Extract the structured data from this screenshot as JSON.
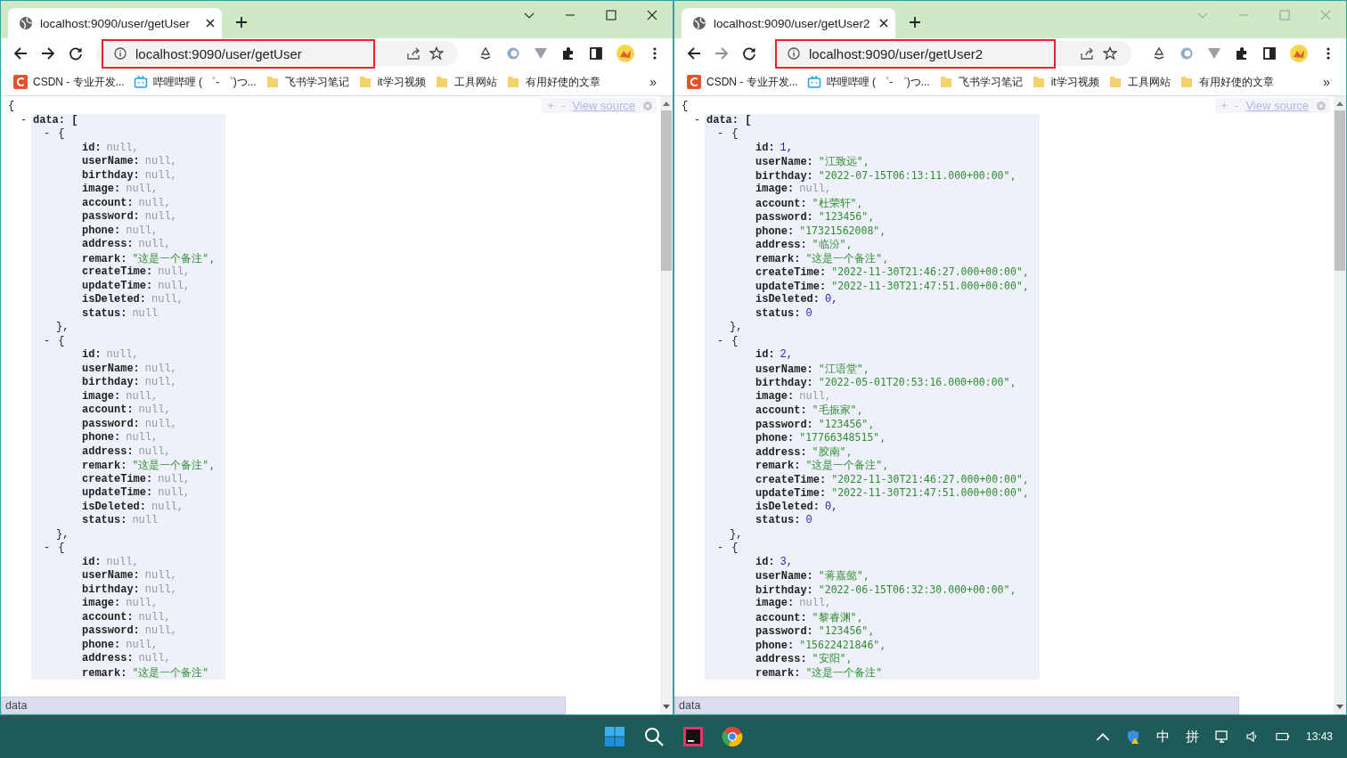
{
  "windows": [
    {
      "active": true,
      "tab_title": "localhost:9090/user/getUser",
      "url": "localhost:9090/user/getUser",
      "url_highlighted": true,
      "bookmarks": [
        {
          "label": "CSDN - 专业开发...",
          "kind": "csdn"
        },
        {
          "label": "哔哩哔哩 ( ゜- ゜)つ...",
          "kind": "tv"
        },
        {
          "label": "飞书学习笔记",
          "kind": "folder"
        },
        {
          "label": "it学习视频",
          "kind": "folder"
        },
        {
          "label": "工具网站",
          "kind": "folder"
        },
        {
          "label": "有用好使的文章",
          "kind": "folder"
        }
      ],
      "bookmarks_more": "»",
      "view_source": {
        "plus": "+",
        "minus": "-",
        "label": "View source"
      },
      "json_view": {
        "open": "{",
        "toggle": "-",
        "data_key": "data: [",
        "records": [
          {
            "toggle": "-",
            "open": "{",
            "close": "},",
            "fields": [
              {
                "key": "id:",
                "value": "null,",
                "kind": "null"
              },
              {
                "key": "userName:",
                "value": "null,",
                "kind": "null"
              },
              {
                "key": "birthday:",
                "value": "null,",
                "kind": "null"
              },
              {
                "key": "image:",
                "value": "null,",
                "kind": "null"
              },
              {
                "key": "account:",
                "value": "null,",
                "kind": "null"
              },
              {
                "key": "password:",
                "value": "null,",
                "kind": "null"
              },
              {
                "key": "phone:",
                "value": "null,",
                "kind": "null"
              },
              {
                "key": "address:",
                "value": "null,",
                "kind": "null"
              },
              {
                "key": "remark:",
                "value": "\"这是一个备注\",",
                "kind": "string"
              },
              {
                "key": "createTime:",
                "value": "null,",
                "kind": "null"
              },
              {
                "key": "updateTime:",
                "value": "null,",
                "kind": "null"
              },
              {
                "key": "isDeleted:",
                "value": "null,",
                "kind": "null"
              },
              {
                "key": "status:",
                "value": "null",
                "kind": "null"
              }
            ]
          },
          {
            "toggle": "-",
            "open": "{",
            "close": "},",
            "fields": [
              {
                "key": "id:",
                "value": "null,",
                "kind": "null"
              },
              {
                "key": "userName:",
                "value": "null,",
                "kind": "null"
              },
              {
                "key": "birthday:",
                "value": "null,",
                "kind": "null"
              },
              {
                "key": "image:",
                "value": "null,",
                "kind": "null"
              },
              {
                "key": "account:",
                "value": "null,",
                "kind": "null"
              },
              {
                "key": "password:",
                "value": "null,",
                "kind": "null"
              },
              {
                "key": "phone:",
                "value": "null,",
                "kind": "null"
              },
              {
                "key": "address:",
                "value": "null,",
                "kind": "null"
              },
              {
                "key": "remark:",
                "value": "\"这是一个备注\",",
                "kind": "string"
              },
              {
                "key": "createTime:",
                "value": "null,",
                "kind": "null"
              },
              {
                "key": "updateTime:",
                "value": "null,",
                "kind": "null"
              },
              {
                "key": "isDeleted:",
                "value": "null,",
                "kind": "null"
              },
              {
                "key": "status:",
                "value": "null",
                "kind": "null"
              }
            ]
          },
          {
            "toggle": "-",
            "open": "{",
            "fields": [
              {
                "key": "id:",
                "value": "null,",
                "kind": "null"
              },
              {
                "key": "userName:",
                "value": "null,",
                "kind": "null"
              },
              {
                "key": "birthday:",
                "value": "null,",
                "kind": "null"
              },
              {
                "key": "image:",
                "value": "null,",
                "kind": "null"
              },
              {
                "key": "account:",
                "value": "null,",
                "kind": "null"
              },
              {
                "key": "password:",
                "value": "null,",
                "kind": "null"
              },
              {
                "key": "phone:",
                "value": "null,",
                "kind": "null"
              },
              {
                "key": "address:",
                "value": "null,",
                "kind": "null"
              },
              {
                "key": "remark:",
                "value": "\"这是一个备注\"",
                "kind": "string"
              }
            ]
          }
        ]
      },
      "status": "data"
    },
    {
      "active": false,
      "tab_title": "localhost:9090/user/getUser2",
      "url": "localhost:9090/user/getUser2",
      "url_highlighted": true,
      "bookmarks": [
        {
          "label": "CSDN - 专业开发...",
          "kind": "csdn"
        },
        {
          "label": "哔哩哔哩 ( ゜- ゜)つ...",
          "kind": "tv"
        },
        {
          "label": "飞书学习笔记",
          "kind": "folder"
        },
        {
          "label": "it学习视频",
          "kind": "folder"
        },
        {
          "label": "工具网站",
          "kind": "folder"
        },
        {
          "label": "有用好使的文章",
          "kind": "folder"
        }
      ],
      "bookmarks_more": "»",
      "view_source": {
        "plus": "+",
        "minus": "-",
        "label": "View source"
      },
      "json_view": {
        "open": "{",
        "toggle": "-",
        "data_key": "data: [",
        "records": [
          {
            "toggle": "-",
            "open": "{",
            "close": "},",
            "fields": [
              {
                "key": "id:",
                "value": "1,",
                "kind": "number"
              },
              {
                "key": "userName:",
                "value": "\"江致远\",",
                "kind": "string"
              },
              {
                "key": "birthday:",
                "value": "\"2022-07-15T06:13:11.000+00:00\",",
                "kind": "string"
              },
              {
                "key": "image:",
                "value": "null,",
                "kind": "null"
              },
              {
                "key": "account:",
                "value": "\"杜荣轩\",",
                "kind": "string"
              },
              {
                "key": "password:",
                "value": "\"123456\",",
                "kind": "string"
              },
              {
                "key": "phone:",
                "value": "\"17321562008\",",
                "kind": "string"
              },
              {
                "key": "address:",
                "value": "\"临汾\",",
                "kind": "string"
              },
              {
                "key": "remark:",
                "value": "\"这是一个备注\",",
                "kind": "string"
              },
              {
                "key": "createTime:",
                "value": "\"2022-11-30T21:46:27.000+00:00\",",
                "kind": "string"
              },
              {
                "key": "updateTime:",
                "value": "\"2022-11-30T21:47:51.000+00:00\",",
                "kind": "string"
              },
              {
                "key": "isDeleted:",
                "value": "0,",
                "kind": "number"
              },
              {
                "key": "status:",
                "value": "0",
                "kind": "number"
              }
            ]
          },
          {
            "toggle": "-",
            "open": "{",
            "close": "},",
            "fields": [
              {
                "key": "id:",
                "value": "2,",
                "kind": "number"
              },
              {
                "key": "userName:",
                "value": "\"江语堂\",",
                "kind": "string"
              },
              {
                "key": "birthday:",
                "value": "\"2022-05-01T20:53:16.000+00:00\",",
                "kind": "string"
              },
              {
                "key": "image:",
                "value": "null,",
                "kind": "null"
              },
              {
                "key": "account:",
                "value": "\"毛振家\",",
                "kind": "string"
              },
              {
                "key": "password:",
                "value": "\"123456\",",
                "kind": "string"
              },
              {
                "key": "phone:",
                "value": "\"17766348515\",",
                "kind": "string"
              },
              {
                "key": "address:",
                "value": "\"胶南\",",
                "kind": "string"
              },
              {
                "key": "remark:",
                "value": "\"这是一个备注\",",
                "kind": "string"
              },
              {
                "key": "createTime:",
                "value": "\"2022-11-30T21:46:27.000+00:00\",",
                "kind": "string"
              },
              {
                "key": "updateTime:",
                "value": "\"2022-11-30T21:47:51.000+00:00\",",
                "kind": "string"
              },
              {
                "key": "isDeleted:",
                "value": "0,",
                "kind": "number"
              },
              {
                "key": "status:",
                "value": "0",
                "kind": "number"
              }
            ]
          },
          {
            "toggle": "-",
            "open": "{",
            "fields": [
              {
                "key": "id:",
                "value": "3,",
                "kind": "number"
              },
              {
                "key": "userName:",
                "value": "\"蒋嘉懿\",",
                "kind": "string"
              },
              {
                "key": "birthday:",
                "value": "\"2022-06-15T06:32:30.000+00:00\",",
                "kind": "string"
              },
              {
                "key": "image:",
                "value": "null,",
                "kind": "null"
              },
              {
                "key": "account:",
                "value": "\"黎睿渊\",",
                "kind": "string"
              },
              {
                "key": "password:",
                "value": "\"123456\",",
                "kind": "string"
              },
              {
                "key": "phone:",
                "value": "\"15622421846\",",
                "kind": "string"
              },
              {
                "key": "address:",
                "value": "\"安阳\",",
                "kind": "string"
              },
              {
                "key": "remark:",
                "value": "\"这是一个备注\"",
                "kind": "string"
              }
            ]
          }
        ]
      },
      "status": "data"
    }
  ],
  "taskbar": {
    "ime_mode": "中",
    "ime": "拼",
    "time": "13:43"
  }
}
